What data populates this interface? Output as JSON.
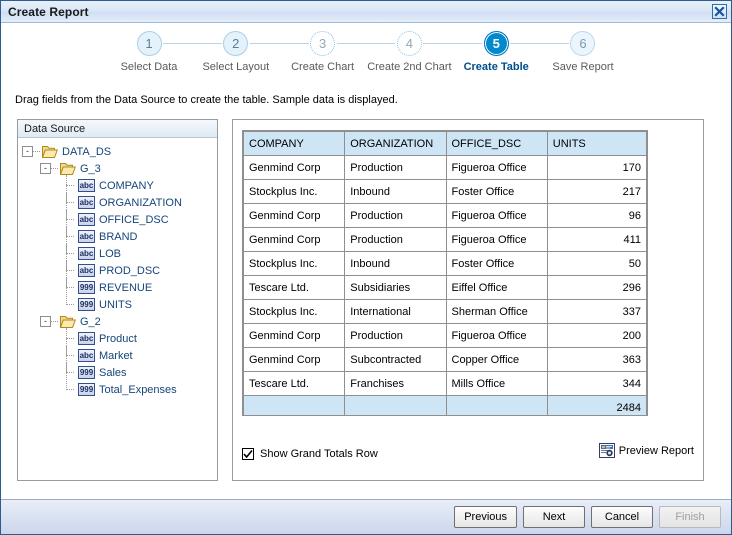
{
  "window": {
    "title": "Create Report",
    "close_icon": "close-x-icon"
  },
  "wizard": {
    "steps": [
      {
        "number": "1",
        "label": "Select Data",
        "state": "done"
      },
      {
        "number": "2",
        "label": "Select Layout",
        "state": "done"
      },
      {
        "number": "3",
        "label": "Create Chart",
        "state": "future"
      },
      {
        "number": "4",
        "label": "Create 2nd Chart",
        "state": "future"
      },
      {
        "number": "5",
        "label": "Create Table",
        "state": "current"
      },
      {
        "number": "6",
        "label": "Save Report",
        "state": "pending"
      }
    ]
  },
  "instruction": "Drag fields from the Data Source to create the table. Sample data is displayed.",
  "data_source": {
    "header": "Data Source",
    "tree": [
      {
        "label": "DATA_DS",
        "kind": "folder",
        "level": 1,
        "expander": "-"
      },
      {
        "label": "G_3",
        "kind": "folder",
        "level": 2,
        "expander": "-"
      },
      {
        "label": "COMPANY",
        "kind": "abc",
        "level": 3
      },
      {
        "label": "ORGANIZATION",
        "kind": "abc",
        "level": 3
      },
      {
        "label": "OFFICE_DSC",
        "kind": "abc",
        "level": 3
      },
      {
        "label": "BRAND",
        "kind": "abc",
        "level": 3
      },
      {
        "label": "LOB",
        "kind": "abc",
        "level": 3
      },
      {
        "label": "PROD_DSC",
        "kind": "abc",
        "level": 3
      },
      {
        "label": "REVENUE",
        "kind": "999",
        "level": 3
      },
      {
        "label": "UNITS",
        "kind": "999",
        "level": 3
      },
      {
        "label": "G_2",
        "kind": "folder",
        "level": 2,
        "expander": "-"
      },
      {
        "label": "Product",
        "kind": "abc",
        "level": 3
      },
      {
        "label": "Market",
        "kind": "abc",
        "level": 3
      },
      {
        "label": "Sales",
        "kind": "999",
        "level": 3
      },
      {
        "label": "Total_Expenses",
        "kind": "999",
        "level": 3
      }
    ],
    "icon_text": {
      "abc": "abc",
      "num": "999"
    }
  },
  "table": {
    "columns": [
      "COMPANY",
      "ORGANIZATION",
      "OFFICE_DSC",
      "UNITS"
    ],
    "rows": [
      [
        "Genmind Corp",
        "Production",
        "Figueroa Office",
        "170"
      ],
      [
        "Stockplus Inc.",
        "Inbound",
        "Foster Office",
        "217"
      ],
      [
        "Genmind Corp",
        "Production",
        "Figueroa Office",
        "96"
      ],
      [
        "Genmind Corp",
        "Production",
        "Figueroa Office",
        "411"
      ],
      [
        "Stockplus Inc.",
        "Inbound",
        "Foster Office",
        "50"
      ],
      [
        "Tescare Ltd.",
        "Subsidiaries",
        "Eiffel Office",
        "296"
      ],
      [
        "Stockplus Inc.",
        "International",
        "Sherman Office",
        "337"
      ],
      [
        "Genmind Corp",
        "Production",
        "Figueroa Office",
        "200"
      ],
      [
        "Genmind Corp",
        "Subcontracted",
        "Copper Office",
        "363"
      ],
      [
        "Tescare Ltd.",
        "Franchises",
        "Mills Office",
        "344"
      ]
    ],
    "grand_total": [
      "",
      "",
      "",
      "2484"
    ]
  },
  "options": {
    "show_grand_totals_label": "Show Grand Totals Row",
    "show_grand_totals_checked": true,
    "preview_report_label": "Preview Report",
    "preview_icon": "preview-report-icon"
  },
  "footer": {
    "previous": "Previous",
    "next": "Next",
    "cancel": "Cancel",
    "finish": "Finish",
    "finish_disabled": true
  },
  "colors": {
    "accent": "#0089cc",
    "header_cell": "#cde5f5",
    "titlebar": "#dbe7f6",
    "tree_text": "#16457a"
  }
}
